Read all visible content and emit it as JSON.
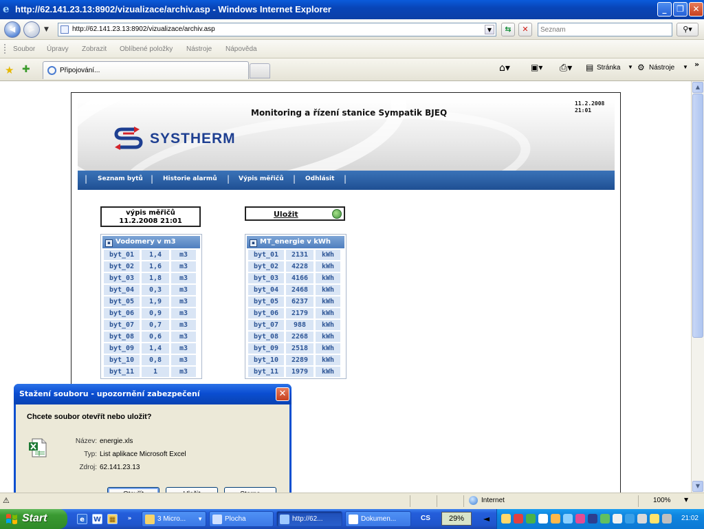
{
  "window": {
    "title": "http://62.141.23.13:8902/vizualizace/archiv.asp - Windows Internet Explorer",
    "minimize": "_",
    "restore": "❐",
    "close": "✕"
  },
  "address": {
    "url": "http://62.141.23.13:8902/vizualizace/archiv.asp",
    "search_placeholder": "Seznam"
  },
  "menu": [
    "Soubor",
    "Úpravy",
    "Zobrazit",
    "Oblíbené položky",
    "Nástroje",
    "Nápověda"
  ],
  "tab": {
    "label": "Připojování..."
  },
  "commandbar": {
    "page": "Stránka",
    "tools": "Nástroje",
    "chevrons": "»"
  },
  "page": {
    "title": "Monitoring a řízení stanice Sympatik BJEQ",
    "date": "11.2.2008",
    "time": "21:01",
    "logo_text": "SYSTHERM",
    "nav": [
      "Seznam bytů",
      "Historie alarmů",
      "Výpis měřičů",
      "Odhlásit"
    ],
    "listing": {
      "line1": "výpis měřičů",
      "line2": "11.2.2008 21:01"
    },
    "save_label": "Uložit"
  },
  "tables": {
    "water": {
      "header": "Vodomery v m3",
      "rows": [
        [
          "byt_01",
          "1,4",
          "m3"
        ],
        [
          "byt_02",
          "1,6",
          "m3"
        ],
        [
          "byt_03",
          "1,8",
          "m3"
        ],
        [
          "byt_04",
          "0,3",
          "m3"
        ],
        [
          "byt_05",
          "1,9",
          "m3"
        ],
        [
          "byt_06",
          "0,9",
          "m3"
        ],
        [
          "byt_07",
          "0,7",
          "m3"
        ],
        [
          "byt_08",
          "0,6",
          "m3"
        ],
        [
          "byt_09",
          "1,4",
          "m3"
        ],
        [
          "byt_10",
          "0,8",
          "m3"
        ],
        [
          "byt_11",
          "1",
          "m3"
        ]
      ]
    },
    "energy": {
      "header": "MT_energie v kWh",
      "rows": [
        [
          "byt_01",
          "2131",
          "kWh"
        ],
        [
          "byt_02",
          "4228",
          "kWh"
        ],
        [
          "byt_03",
          "4166",
          "kWh"
        ],
        [
          "byt_04",
          "2468",
          "kWh"
        ],
        [
          "byt_05",
          "6237",
          "kWh"
        ],
        [
          "byt_06",
          "2179",
          "kWh"
        ],
        [
          "byt_07",
          "988",
          "kWh"
        ],
        [
          "byt_08",
          "2268",
          "kWh"
        ],
        [
          "byt_09",
          "2518",
          "kWh"
        ],
        [
          "byt_10",
          "2289",
          "kWh"
        ],
        [
          "byt_11",
          "1979",
          "kWh"
        ]
      ]
    }
  },
  "dialog": {
    "title": "Stažení souboru - upozornění zabezpečení",
    "question": "Chcete soubor otevřít nebo uložit?",
    "name_label": "Název:",
    "name_value": "energie.xls",
    "type_label": "Typ:",
    "type_value": "List aplikace Microsoft Excel",
    "source_label": "Zdroj:",
    "source_value": "62.141.23.13",
    "open": "Otevřít",
    "save": "Uložit",
    "cancel": "Storno"
  },
  "status": {
    "zone": "Internet",
    "zoom": "100%"
  },
  "taskbar": {
    "start": "Start",
    "buttons": [
      "3 Micro...",
      "Plocha",
      "http://62...",
      "Dokumen..."
    ],
    "lang": "CS",
    "cpu": "29%",
    "clock": "21:02"
  }
}
